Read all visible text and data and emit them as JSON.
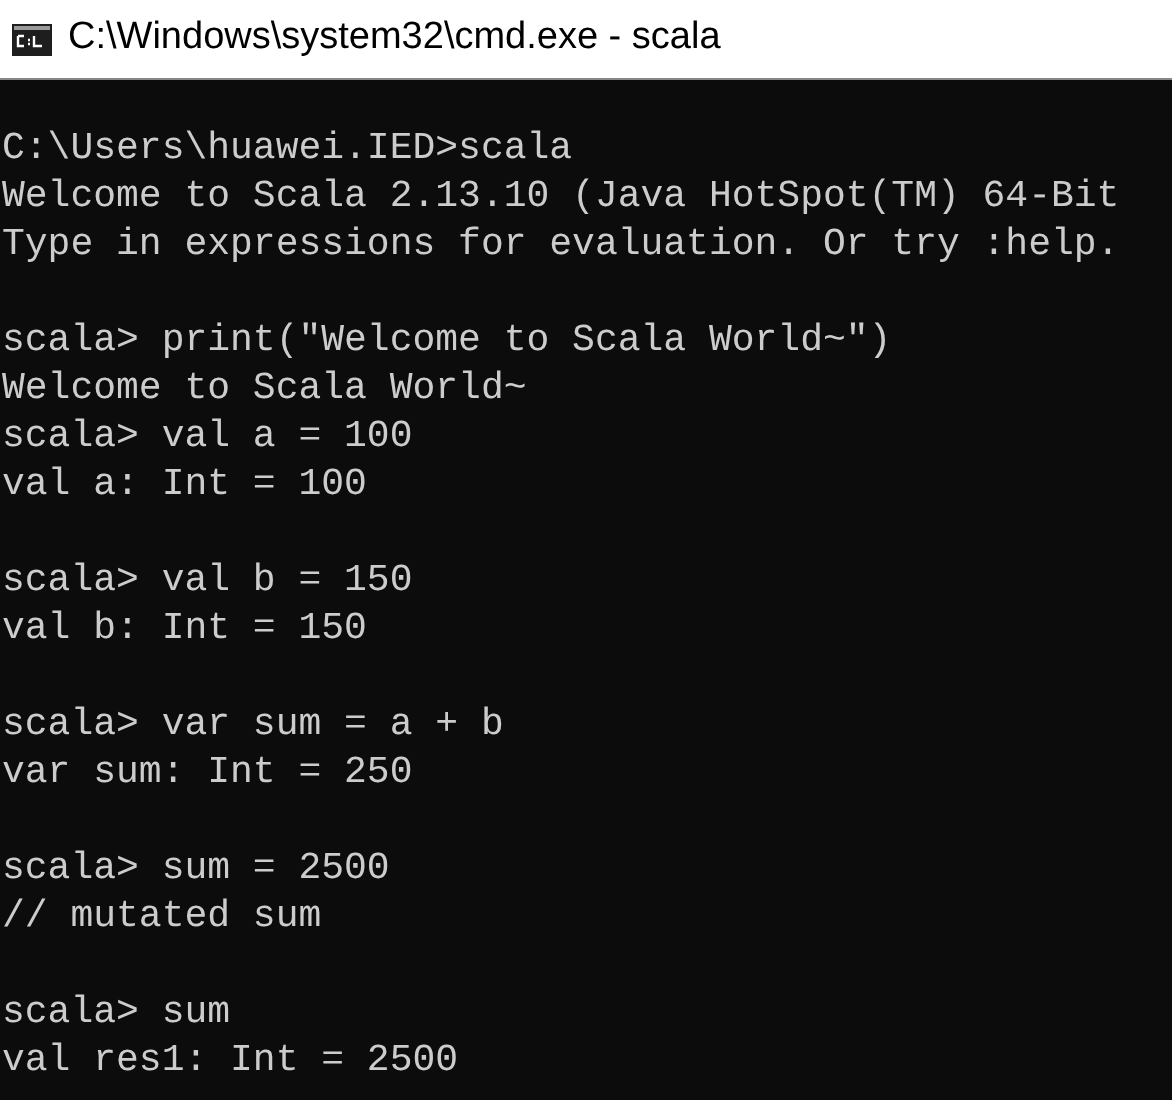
{
  "window": {
    "title": "C:\\Windows\\system32\\cmd.exe - scala"
  },
  "console": {
    "blocks": [
      [
        "C:\\Users\\huawei.IED>scala",
        "Welcome to Scala 2.13.10 (Java HotSpot(TM) 64-Bit",
        "Type in expressions for evaluation. Or try :help."
      ],
      [
        "scala> print(\"Welcome to Scala World~\")",
        "Welcome to Scala World~",
        "scala> val a = 100",
        "val a: Int = 100"
      ],
      [
        "scala> val b = 150",
        "val b: Int = 150"
      ],
      [
        "scala> var sum = a + b",
        "var sum: Int = 250"
      ],
      [
        "scala> sum = 2500",
        "// mutated sum"
      ],
      [
        "scala> sum",
        "val res1: Int = 2500"
      ]
    ]
  }
}
